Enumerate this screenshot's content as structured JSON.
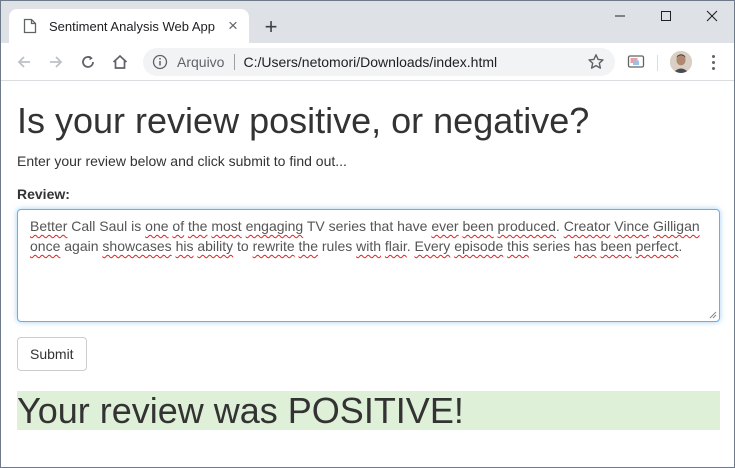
{
  "browser": {
    "tab_title": "Sentiment Analysis Web App",
    "tab_close": "×",
    "new_tab": "+",
    "origin_label": "Arquivo",
    "url": "C:/Users/netomori/Downloads/index.html"
  },
  "page": {
    "heading": "Is your review positive, or negative?",
    "intro": "Enter your review below and click submit to find out...",
    "review_label": "Review:",
    "review_words": [
      {
        "t": "Better",
        "s": true
      },
      {
        "t": " ",
        "s": false
      },
      {
        "t": "Call Saul is ",
        "s": false
      },
      {
        "t": "one",
        "s": true
      },
      {
        "t": " ",
        "s": false
      },
      {
        "t": "of",
        "s": true
      },
      {
        "t": " ",
        "s": false
      },
      {
        "t": "the",
        "s": true
      },
      {
        "t": " ",
        "s": false
      },
      {
        "t": "most",
        "s": true
      },
      {
        "t": " ",
        "s": false
      },
      {
        "t": "engaging",
        "s": true
      },
      {
        "t": " TV series that have ",
        "s": false
      },
      {
        "t": "ever",
        "s": true
      },
      {
        "t": " ",
        "s": false
      },
      {
        "t": "been",
        "s": true
      },
      {
        "t": " ",
        "s": false
      },
      {
        "t": "produced",
        "s": true
      },
      {
        "t": ". ",
        "s": false
      },
      {
        "t": "Creator",
        "s": true
      },
      {
        "t": " ",
        "s": false
      },
      {
        "t": "Vince",
        "s": true
      },
      {
        "t": " ",
        "s": false
      },
      {
        "t": "Gilligan",
        "s": true
      },
      {
        "t": " ",
        "s": false
      },
      {
        "t": "once",
        "s": true
      },
      {
        "t": " again ",
        "s": false
      },
      {
        "t": "showcases",
        "s": true
      },
      {
        "t": " ",
        "s": false
      },
      {
        "t": "his",
        "s": true
      },
      {
        "t": " ",
        "s": false
      },
      {
        "t": "ability",
        "s": true
      },
      {
        "t": " to ",
        "s": false
      },
      {
        "t": "rewrite",
        "s": true
      },
      {
        "t": " ",
        "s": false
      },
      {
        "t": "the",
        "s": true
      },
      {
        "t": " rules ",
        "s": false
      },
      {
        "t": "with",
        "s": true
      },
      {
        "t": " ",
        "s": false
      },
      {
        "t": "flair",
        "s": true
      },
      {
        "t": ". ",
        "s": false
      },
      {
        "t": "Every",
        "s": true
      },
      {
        "t": " ",
        "s": false
      },
      {
        "t": "episode",
        "s": true
      },
      {
        "t": " ",
        "s": false
      },
      {
        "t": "this",
        "s": true
      },
      {
        "t": " series ",
        "s": false
      },
      {
        "t": "has",
        "s": true
      },
      {
        "t": " ",
        "s": false
      },
      {
        "t": "been",
        "s": true
      },
      {
        "t": " ",
        "s": false
      },
      {
        "t": "perfect",
        "s": true
      },
      {
        "t": ".",
        "s": false
      }
    ],
    "submit_label": "Submit",
    "result": "Your review was POSITIVE!"
  },
  "colors": {
    "result_bg": "#dff0d8",
    "focus_border": "#66afe9",
    "spell_underline": "#e02020",
    "tabstrip_bg": "#dee1e6"
  },
  "icons": [
    "document-icon",
    "close-icon",
    "plus-icon",
    "minimize-icon",
    "maximize-icon",
    "window-close-icon",
    "back-arrow-icon",
    "forward-arrow-icon",
    "reload-icon",
    "home-icon",
    "info-icon",
    "star-icon",
    "cast-icon",
    "avatar",
    "menu-dots-icon"
  ]
}
